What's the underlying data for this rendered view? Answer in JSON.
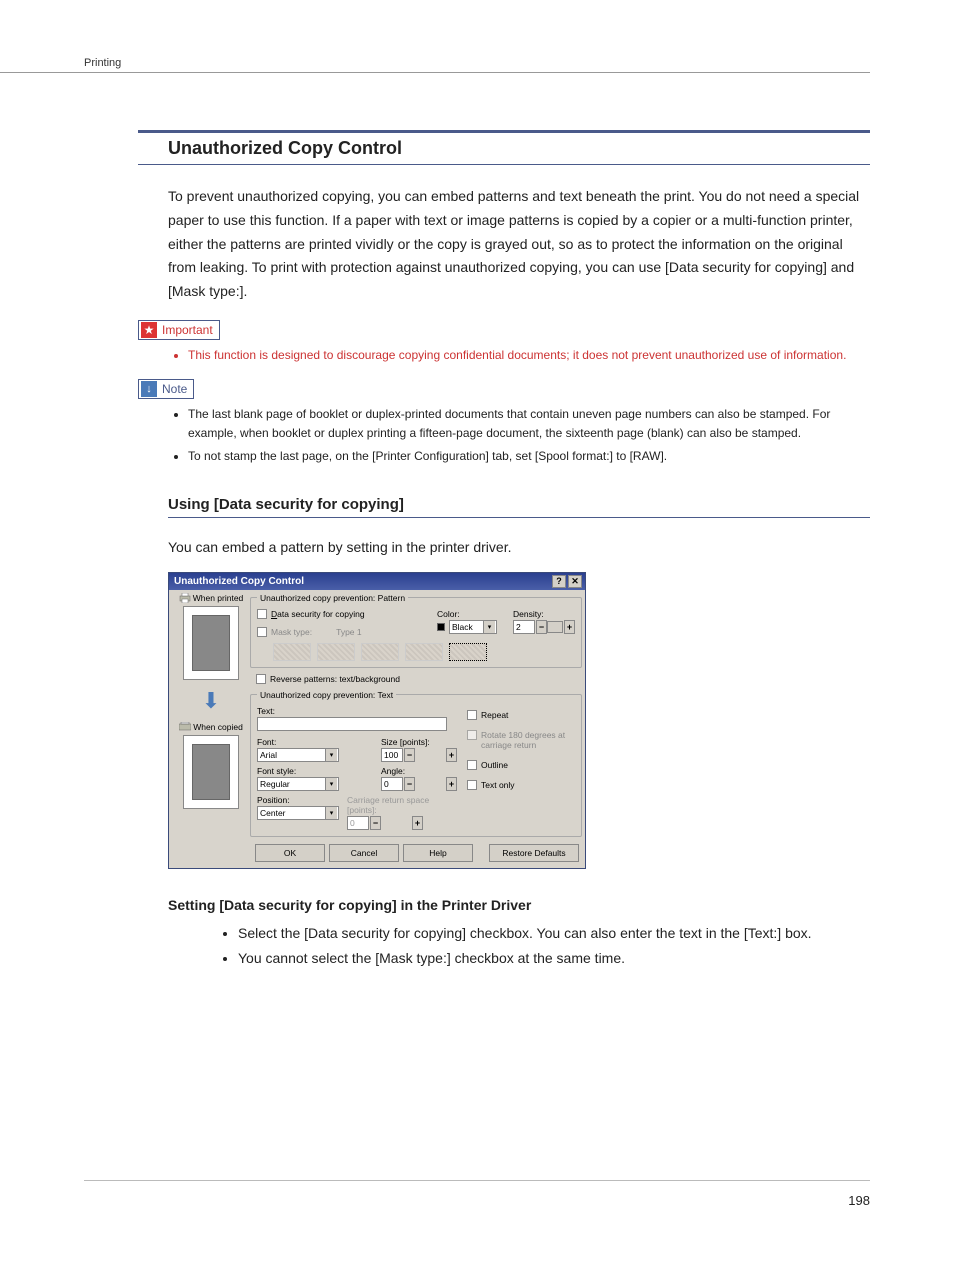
{
  "page": {
    "header_section": "Printing",
    "number": "198"
  },
  "heading": "Unauthorized Copy Control",
  "intro": "To prevent unauthorized copying, you can embed patterns and text beneath the print. You do not need a special paper to use this function. If a paper with text or image patterns is copied by a copier or a multi-function printer, either the patterns are printed vividly or the copy is grayed out, so as to protect the information on the original from leaking. To print with protection against unauthorized copying, you can use [Data security for copying] and [Mask type:].",
  "important_label": "Important",
  "important_items": [
    "This function is designed to discourage copying confidential documents; it does not prevent unauthorized use of information."
  ],
  "note_label": "Note",
  "note_items": [
    "The last blank page of booklet or duplex-printed documents that contain uneven page numbers can also be stamped. For example, when booklet or duplex printing a fifteen-page document, the sixteenth page (blank) can also be stamped.",
    "To not stamp the last page, on the [Printer Configuration] tab, set [Spool format:] to [RAW]."
  ],
  "h3": "Using [Data security for copying]",
  "h3_intro": "You can embed a pattern by setting in the printer driver.",
  "dialog": {
    "title": "Unauthorized Copy Control",
    "when_printed": "When printed",
    "when_copied": "When copied",
    "group_pattern": "Unauthorized copy prevention: Pattern",
    "data_security_label": "Data security for copying",
    "mask_type_label": "Mask type:",
    "mask_type_value": "Type 1",
    "color_label": "Color:",
    "color_value": "Black",
    "density_label": "Density:",
    "density_value": "2",
    "reverse_label": "Reverse patterns: text/background",
    "group_text": "Unauthorized copy prevention: Text",
    "text_label": "Text:",
    "font_label": "Font:",
    "font_value": "Arial",
    "size_label": "Size [points]:",
    "size_value": "100",
    "fontstyle_label": "Font style:",
    "fontstyle_value": "Regular",
    "angle_label": "Angle:",
    "angle_value": "0",
    "position_label": "Position:",
    "position_value": "Center",
    "crspace_label": "Carriage return space [points]:",
    "crspace_value": "0",
    "repeat_label": "Repeat",
    "rotate_label": "Rotate 180 degrees at carriage return",
    "outline_label": "Outline",
    "textonly_label": "Text only",
    "btn_ok": "OK",
    "btn_cancel": "Cancel",
    "btn_help": "Help",
    "btn_defaults": "Restore Defaults"
  },
  "subhead": "Setting [Data security for copying] in the Printer Driver",
  "steps": [
    "Select the [Data security for copying] checkbox. You can also enter the text in the [Text:] box.",
    "You cannot select the [Mask type:] checkbox at the same time."
  ]
}
